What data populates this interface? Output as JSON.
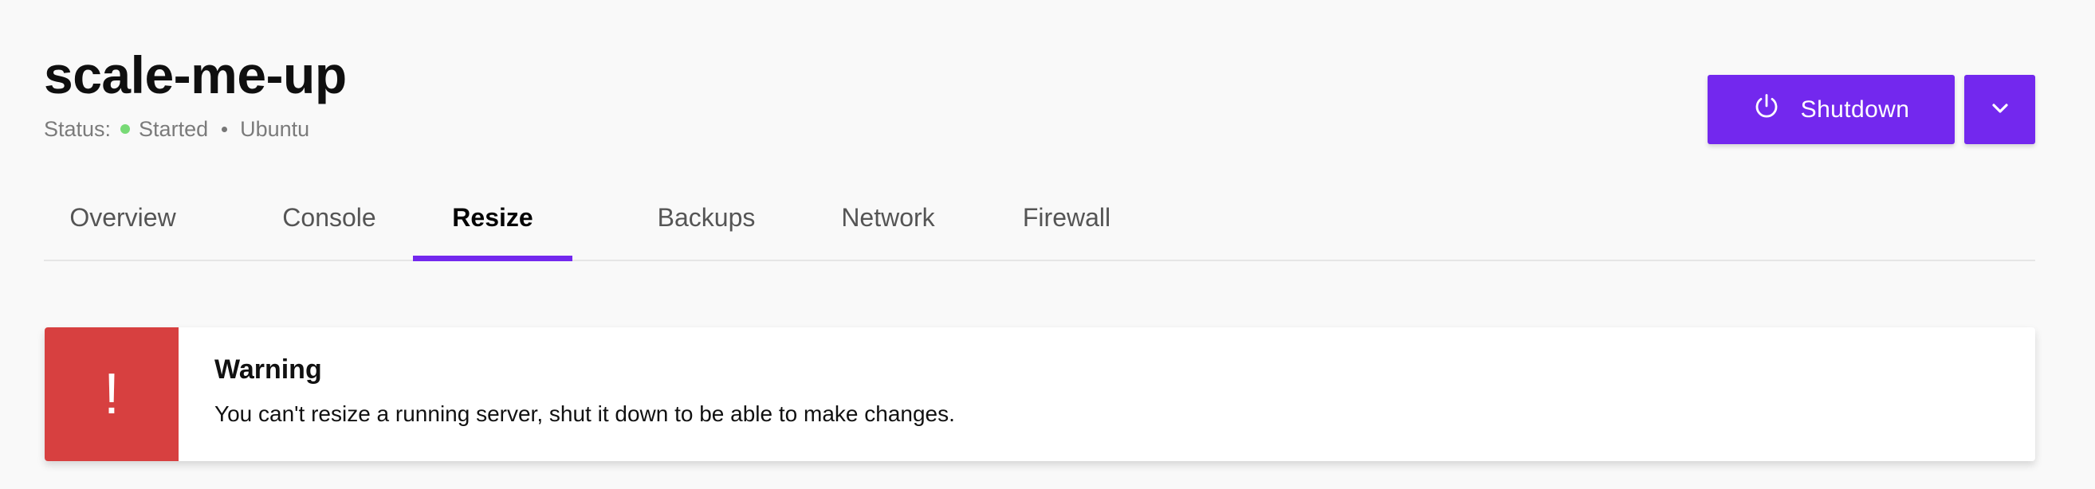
{
  "theme": {
    "accent": "#7328ee",
    "danger": "#d74040",
    "status_green": "#78da76"
  },
  "server": {
    "name": "scale-me-up",
    "status_label": "Status:",
    "status": "Started",
    "os": "Ubuntu"
  },
  "actions": {
    "shutdown_label": "Shutdown",
    "shutdown_icon": "power-icon",
    "more_icon": "chevron-down-icon"
  },
  "tabs": [
    {
      "label": "Overview",
      "active": false
    },
    {
      "label": "Console",
      "active": false
    },
    {
      "label": "Resize",
      "active": true
    },
    {
      "label": "Backups",
      "active": false
    },
    {
      "label": "Network",
      "active": false
    },
    {
      "label": "Firewall",
      "active": false
    }
  ],
  "alert": {
    "icon": "!",
    "title": "Warning",
    "message": "You can't resize a running server, shut it down to be able to make changes."
  }
}
